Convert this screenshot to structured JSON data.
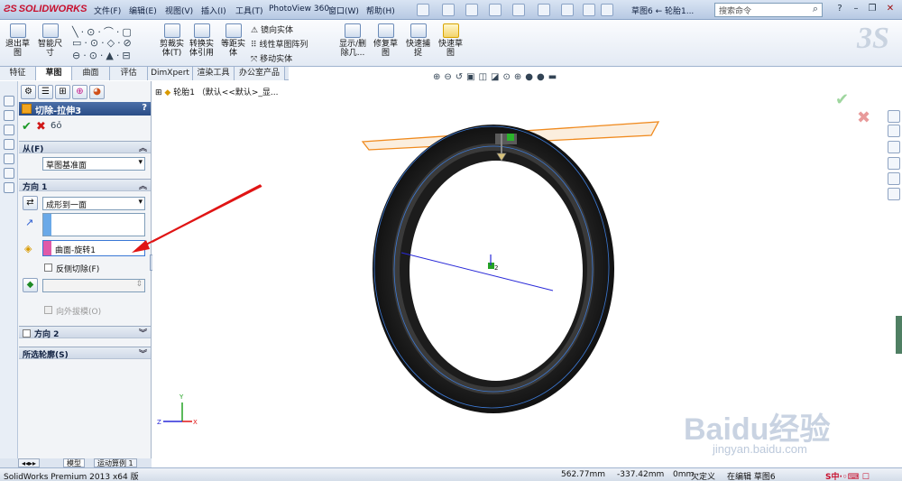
{
  "app": {
    "logo": "SOLIDWORKS",
    "doc_title": "草图6 ← 轮胎1...",
    "search_placeholder": "搜索命令"
  },
  "menu": [
    "文件(F)",
    "编辑(E)",
    "视图(V)",
    "插入(I)",
    "工具(T)",
    "PhotoView 360",
    "窗口(W)",
    "帮助(H)"
  ],
  "ribbon": {
    "exit_sketch": "退出草\n图",
    "smart_dim": "智能尺\n寸",
    "trim": "剪裁实\n体(T)",
    "convert": "转换实\n体引用",
    "offset": "等距实\n体",
    "mirror": "镜向实体",
    "linear_pattern": "线性草图阵列",
    "move": "移动实体",
    "show_delete": "显示/删\n除几...",
    "repair": "修复草\n图",
    "quick_snap": "快速捕\n捉",
    "rapid_sketch": "快速草\n图"
  },
  "tabs": [
    "特征",
    "草图",
    "曲面",
    "评估",
    "DimXpert",
    "渲染工具",
    "办公室产品"
  ],
  "active_tab": "草图",
  "pm": {
    "title": "切除-拉伸3",
    "help": "?",
    "from_header": "从(F)",
    "from_value": "草图基准面",
    "dir1_header": "方向 1",
    "end_condition": "成形到一面",
    "face_value": "曲面-旋转1",
    "flip_side": "反侧切除(F)",
    "draft_outward": "向外拔模(O)",
    "dir2_header": "方向 2",
    "contours_header": "所选轮廓(S)"
  },
  "tree": {
    "label": "轮胎1 （默认<<默认>_显..."
  },
  "bottom_tabs": [
    "模型",
    "运动算例 1"
  ],
  "status": {
    "product": "SolidWorks Premium 2013 x64 版",
    "x": "562.77mm",
    "y": "-337.42mm",
    "z": "0mm",
    "defined": "欠定义",
    "editing": "在编辑 草图6"
  },
  "watermark": {
    "brand": "Baidu经验",
    "url": "jingyan.baidu.com"
  },
  "colors": {
    "accent": "#2a4c86",
    "tire": "#1a1a1a",
    "plane": "#f08a1e",
    "arrow": "#e01515"
  }
}
